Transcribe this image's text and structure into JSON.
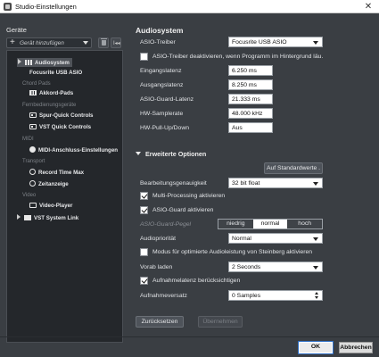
{
  "window": {
    "title": "Studio-Einstellungen",
    "close_glyph": "✕"
  },
  "left": {
    "header": "Geräte",
    "add_device": "Gerät hinzufügen",
    "reset_glyph": "I◂◂",
    "tree": {
      "audiosystem": "Audiosystem",
      "focusrite": "Focusrite USB ASIO",
      "cat_chord": "Chord Pads",
      "akkord": "Akkord-Pads",
      "cat_remote": "Fernbedienungsgeräte",
      "spur": "Spur-Quick Controls",
      "vst_qc": "VST Quick Controls",
      "cat_midi": "MIDI",
      "midi_anschluss": "MIDI-Anschluss-Einstellungen",
      "cat_transport": "Transport",
      "record_time": "Record Time Max",
      "zeitanzeige": "Zeitanzeige",
      "cat_video": "Video",
      "video_player": "Video-Player",
      "vst_link": "VST System Link"
    }
  },
  "audiosystem": {
    "title": "Audiosystem",
    "asio_driver_label": "ASIO-Treiber",
    "asio_driver_value": "Focusrite USB ASIO",
    "deactivate_label": "ASIO-Treiber deaktivieren, wenn Programm im Hintergrund läu.",
    "deactivate_checked": false,
    "input_latency_label": "Eingangslatenz",
    "input_latency": "6.250 ms",
    "output_latency_label": "Ausgangslatenz",
    "output_latency": "8.250 ms",
    "guard_latency_label": "ASIO-Guard-Latenz",
    "guard_latency": "21.333 ms",
    "samplerate_label": "HW-Samplerate",
    "samplerate": "48.000 kHz",
    "pullupdown_label": "HW-Pull-Up/Down",
    "pullupdown": "Aus"
  },
  "advanced": {
    "title": "Erweiterte Optionen",
    "defaults_button": "Auf Standardwerte .",
    "precision_label": "Bearbeitungsgenauigkeit",
    "precision_value": "32 bit float",
    "multiprocessing_label": "Multi-Processing aktivieren",
    "multiprocessing_checked": true,
    "asio_guard_label": "ASIO-Guard aktivieren",
    "asio_guard_checked": true,
    "guard_level_label": "ASIO-Guard-Pegel",
    "guard_levels": [
      "niedrig",
      "normal",
      "hoch"
    ],
    "guard_level_selected": "normal",
    "priority_label": "Audiopriorität",
    "priority_value": "Normal",
    "optimized_label": "Modus für optimierte Audioleistung von Steinberg aktivieren",
    "optimized_checked": false,
    "preload_label": "Vorab laden",
    "preload_value": "2 Seconds",
    "rec_latency_label": "Aufnahmelatenz berücksichtigen",
    "rec_latency_checked": true,
    "rec_offset_label": "Aufnahmeversatz",
    "rec_offset_value": "0 Samples"
  },
  "actions": {
    "reset": "Zurücksetzen",
    "apply": "Übernehmen",
    "ok": "OK",
    "cancel": "Abbrechen"
  }
}
